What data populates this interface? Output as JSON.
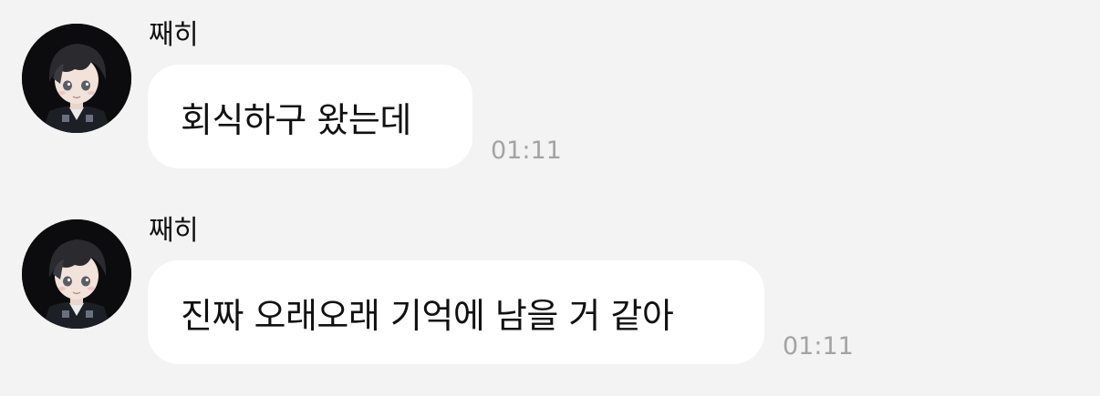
{
  "messages": [
    {
      "sender": "째히",
      "text": "회식하구 왔는데",
      "time": "01:11"
    },
    {
      "sender": "째히",
      "text": "진짜 오래오래 기억에 남을 거 같아",
      "time": "01:11"
    }
  ],
  "colors": {
    "background": "#f3f3f3",
    "bubble": "#ffffff",
    "text": "#111111",
    "timestamp": "#a3a3a3"
  }
}
